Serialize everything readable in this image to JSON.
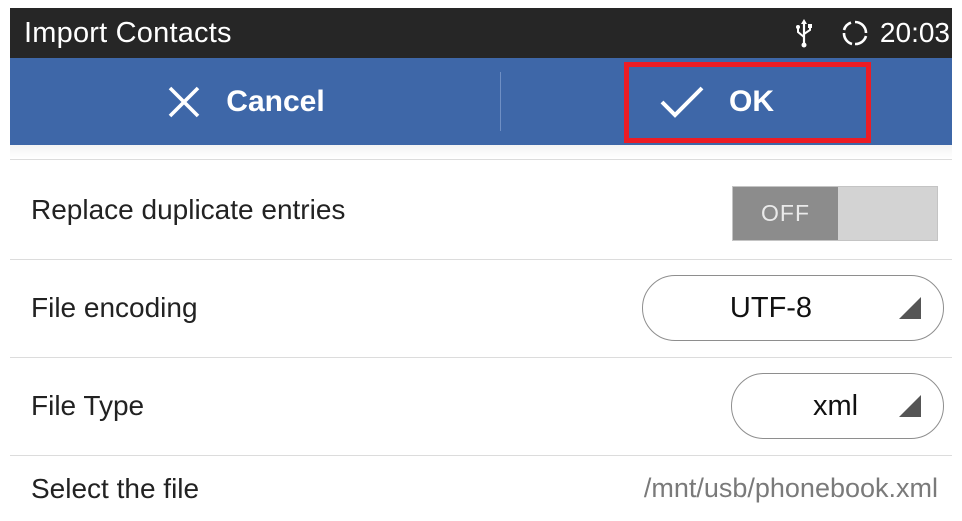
{
  "status_bar": {
    "title": "Import Contacts",
    "time": "20:03",
    "icons": [
      "usb-icon",
      "sync-icon"
    ]
  },
  "action_bar": {
    "cancel_label": "Cancel",
    "ok_label": "OK",
    "background": "#3e67a8",
    "highlight_color": "#ec1c24"
  },
  "settings": {
    "replace_duplicates": {
      "label": "Replace duplicate entries",
      "toggle_text": "OFF"
    },
    "file_encoding": {
      "label": "File encoding",
      "value": "UTF-8"
    },
    "file_type": {
      "label": "File Type",
      "value": "xml"
    },
    "select_file": {
      "label": "Select the file",
      "value": "/mnt/usb/phonebook.xml"
    }
  }
}
